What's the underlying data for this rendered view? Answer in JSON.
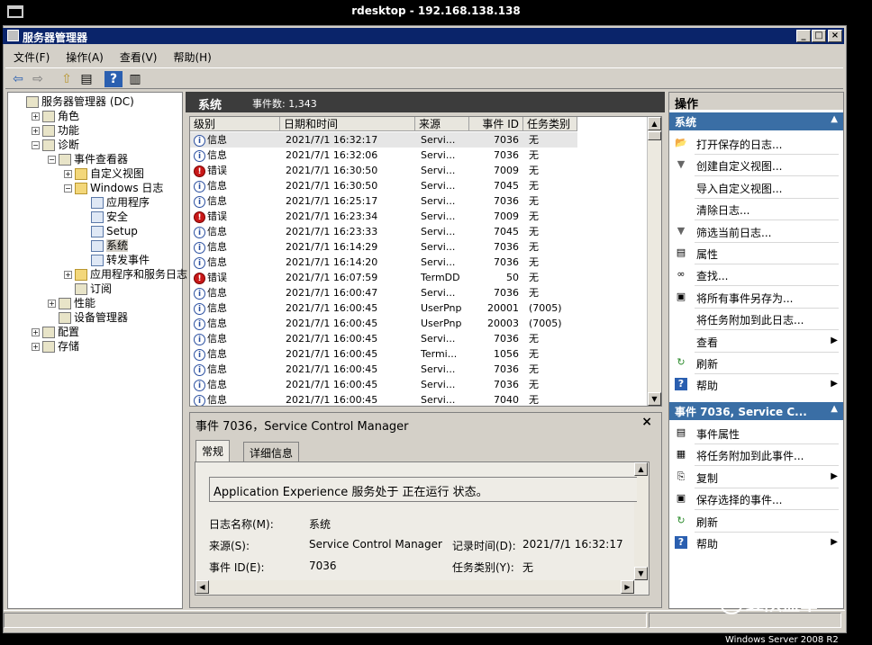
{
  "rdp": {
    "title": "rdesktop - 192.168.138.138"
  },
  "window": {
    "title": "服务器管理器",
    "btn_min": "_",
    "btn_max": "□",
    "btn_close": "×"
  },
  "menu": [
    {
      "label": "文件(F)"
    },
    {
      "label": "操作(A)"
    },
    {
      "label": "查看(V)"
    },
    {
      "label": "帮助(H)"
    }
  ],
  "toolbar": [
    {
      "icon": "back-arrow-icon",
      "glyph": "⇦"
    },
    {
      "icon": "forward-arrow-icon",
      "glyph": "⇨"
    },
    {
      "icon": "up-folder-icon",
      "glyph": "⇧"
    },
    {
      "icon": "show-tree-icon",
      "glyph": "▤"
    },
    {
      "icon": "help-icon",
      "glyph": "?"
    },
    {
      "icon": "action-pane-icon",
      "glyph": "▥"
    }
  ],
  "tree": [
    {
      "label": "服务器管理器 (DC)",
      "level": 0,
      "exp": "",
      "icon": "server-manager-icon"
    },
    {
      "label": "角色",
      "level": 1,
      "exp": "+",
      "icon": "roles-icon"
    },
    {
      "label": "功能",
      "level": 1,
      "exp": "+",
      "icon": "features-icon"
    },
    {
      "label": "诊断",
      "level": 1,
      "exp": "-",
      "icon": "diagnostics-icon"
    },
    {
      "label": "事件查看器",
      "level": 2,
      "exp": "-",
      "icon": "event-viewer-icon"
    },
    {
      "label": "自定义视图",
      "level": 3,
      "exp": "+",
      "icon": "folder-icon"
    },
    {
      "label": "Windows 日志",
      "level": 3,
      "exp": "-",
      "icon": "folder-icon"
    },
    {
      "label": "应用程序",
      "level": 4,
      "exp": "",
      "icon": "log-icon"
    },
    {
      "label": "安全",
      "level": 4,
      "exp": "",
      "icon": "log-icon"
    },
    {
      "label": "Setup",
      "level": 4,
      "exp": "",
      "icon": "log-icon"
    },
    {
      "label": "系统",
      "level": 4,
      "exp": "",
      "icon": "log-icon",
      "selected": true
    },
    {
      "label": "转发事件",
      "level": 4,
      "exp": "",
      "icon": "log-icon"
    },
    {
      "label": "应用程序和服务日志",
      "level": 3,
      "exp": "+",
      "icon": "folder-icon"
    },
    {
      "label": "订阅",
      "level": 3,
      "exp": "",
      "icon": "subscriptions-icon"
    },
    {
      "label": "性能",
      "level": 2,
      "exp": "+",
      "icon": "performance-icon"
    },
    {
      "label": "设备管理器",
      "level": 2,
      "exp": "",
      "icon": "device-manager-icon"
    },
    {
      "label": "配置",
      "level": 1,
      "exp": "+",
      "icon": "configuration-icon"
    },
    {
      "label": "存储",
      "level": 1,
      "exp": "+",
      "icon": "storage-icon"
    }
  ],
  "center": {
    "title": "系统",
    "count": "事件数: 1,343"
  },
  "grid": {
    "columns": [
      "级别",
      "日期和时间",
      "来源",
      "事件 ID",
      "任务类别"
    ],
    "rows": [
      {
        "level": "信息",
        "type": "info",
        "date": "2021/7/1 16:32:17",
        "source": "Servi...",
        "id": "7036",
        "task": "无",
        "selected": true
      },
      {
        "level": "信息",
        "type": "info",
        "date": "2021/7/1 16:32:06",
        "source": "Servi...",
        "id": "7036",
        "task": "无"
      },
      {
        "level": "错误",
        "type": "err",
        "date": "2021/7/1 16:30:50",
        "source": "Servi...",
        "id": "7009",
        "task": "无"
      },
      {
        "level": "信息",
        "type": "info",
        "date": "2021/7/1 16:30:50",
        "source": "Servi...",
        "id": "7045",
        "task": "无"
      },
      {
        "level": "信息",
        "type": "info",
        "date": "2021/7/1 16:25:17",
        "source": "Servi...",
        "id": "7036",
        "task": "无"
      },
      {
        "level": "错误",
        "type": "err",
        "date": "2021/7/1 16:23:34",
        "source": "Servi...",
        "id": "7009",
        "task": "无"
      },
      {
        "level": "信息",
        "type": "info",
        "date": "2021/7/1 16:23:33",
        "source": "Servi...",
        "id": "7045",
        "task": "无"
      },
      {
        "level": "信息",
        "type": "info",
        "date": "2021/7/1 16:14:29",
        "source": "Servi...",
        "id": "7036",
        "task": "无"
      },
      {
        "level": "信息",
        "type": "info",
        "date": "2021/7/1 16:14:20",
        "source": "Servi...",
        "id": "7036",
        "task": "无"
      },
      {
        "level": "错误",
        "type": "err",
        "date": "2021/7/1 16:07:59",
        "source": "TermDD",
        "id": "50",
        "task": "无"
      },
      {
        "level": "信息",
        "type": "info",
        "date": "2021/7/1 16:00:47",
        "source": "Servi...",
        "id": "7036",
        "task": "无"
      },
      {
        "level": "信息",
        "type": "info",
        "date": "2021/7/1 16:00:45",
        "source": "UserPnp",
        "id": "20001",
        "task": "(7005)"
      },
      {
        "level": "信息",
        "type": "info",
        "date": "2021/7/1 16:00:45",
        "source": "UserPnp",
        "id": "20003",
        "task": "(7005)"
      },
      {
        "level": "信息",
        "type": "info",
        "date": "2021/7/1 16:00:45",
        "source": "Servi...",
        "id": "7036",
        "task": "无"
      },
      {
        "level": "信息",
        "type": "info",
        "date": "2021/7/1 16:00:45",
        "source": "Termi...",
        "id": "1056",
        "task": "无"
      },
      {
        "level": "信息",
        "type": "info",
        "date": "2021/7/1 16:00:45",
        "source": "Servi...",
        "id": "7036",
        "task": "无"
      },
      {
        "level": "信息",
        "type": "info",
        "date": "2021/7/1 16:00:45",
        "source": "Servi...",
        "id": "7036",
        "task": "无"
      },
      {
        "level": "信息",
        "type": "info",
        "date": "2021/7/1 16:00:45",
        "source": "Servi...",
        "id": "7040",
        "task": "无"
      }
    ]
  },
  "detail": {
    "title": "事件 7036，Service Control Manager",
    "close": "×",
    "tabs": [
      "常规",
      "详细信息"
    ],
    "message": "Application Experience 服务处于 正在运行 状态。",
    "log_name_label": "日志名称(M):",
    "log_name": "系统",
    "source_label": "来源(S):",
    "source": "Service Control Manager",
    "logged_label": "记录时间(D):",
    "logged": "2021/7/1 16:32:17",
    "event_id_label": "事件 ID(E):",
    "event_id": "7036",
    "task_label": "任务类别(Y):",
    "task": "无"
  },
  "actions": {
    "title": "操作",
    "section1": "系统",
    "items1": [
      {
        "label": "打开保存的日志...",
        "icon": "open-folder-icon",
        "glyph": "📂",
        "arrow": ""
      },
      {
        "label": "创建自定义视图...",
        "icon": "filter-icon",
        "glyph": "▼",
        "arrow": ""
      },
      {
        "label": "导入自定义视图...",
        "icon": "",
        "glyph": "",
        "arrow": ""
      },
      {
        "label": "清除日志...",
        "icon": "",
        "glyph": "",
        "arrow": ""
      },
      {
        "label": "筛选当前日志...",
        "icon": "filter-icon",
        "glyph": "▼",
        "arrow": ""
      },
      {
        "label": "属性",
        "icon": "properties-icon",
        "glyph": "▤",
        "arrow": ""
      },
      {
        "label": "查找...",
        "icon": "binoculars-icon",
        "glyph": "∞",
        "arrow": ""
      },
      {
        "label": "将所有事件另存为...",
        "icon": "save-icon",
        "glyph": "▣",
        "arrow": ""
      },
      {
        "label": "将任务附加到此日志...",
        "icon": "",
        "glyph": "",
        "arrow": ""
      },
      {
        "label": "查看",
        "icon": "",
        "glyph": "",
        "arrow": "▶"
      },
      {
        "label": "刷新",
        "icon": "refresh-icon",
        "glyph": "↻",
        "arrow": ""
      },
      {
        "label": "帮助",
        "icon": "help-icon",
        "glyph": "?",
        "arrow": "▶"
      }
    ],
    "section2": "事件 7036, Service C...",
    "items2": [
      {
        "label": "事件属性",
        "icon": "event-properties-icon",
        "glyph": "▤",
        "arrow": ""
      },
      {
        "label": "将任务附加到此事件...",
        "icon": "attach-task-icon",
        "glyph": "▦",
        "arrow": ""
      },
      {
        "label": "复制",
        "icon": "copy-icon",
        "glyph": "⎘",
        "arrow": "▶"
      },
      {
        "label": "保存选择的事件...",
        "icon": "save-icon",
        "glyph": "▣",
        "arrow": ""
      },
      {
        "label": "刷新",
        "icon": "refresh-icon",
        "glyph": "↻",
        "arrow": ""
      },
      {
        "label": "帮助",
        "icon": "help-icon",
        "glyph": "?",
        "arrow": "▶"
      }
    ]
  },
  "watermark": "红队蓝军",
  "os_footer": "Windows Server 2008 R2",
  "colors": {
    "titlebar": "#0a246a",
    "section_header": "#3a6ea5",
    "error": "#c81818",
    "info": "#2a4fa0"
  }
}
